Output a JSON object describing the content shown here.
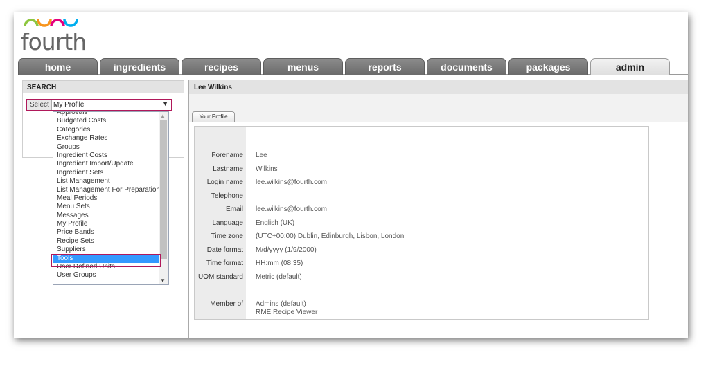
{
  "brand": {
    "logo_text": "fourth",
    "colors": [
      "#8dc63f",
      "#f7941d",
      "#e5007e",
      "#00aeef"
    ]
  },
  "tabs": [
    {
      "label": "home"
    },
    {
      "label": "ingredients"
    },
    {
      "label": "recipes"
    },
    {
      "label": "menus"
    },
    {
      "label": "reports"
    },
    {
      "label": "documents"
    },
    {
      "label": "packages"
    },
    {
      "label": "admin",
      "active": true
    }
  ],
  "search": {
    "title": "SEARCH",
    "select_label": "Select",
    "selected_value": "My Profile",
    "options": [
      "Approvals",
      "Budgeted Costs",
      "Categories",
      "Exchange Rates",
      "Groups",
      "Ingredient Costs",
      "Ingredient Import/Update",
      "Ingredient Sets",
      "List Management",
      "List Management For Preparation",
      "Meal Periods",
      "Menu Sets",
      "Messages",
      "My Profile",
      "Price Bands",
      "Recipe Sets",
      "Suppliers",
      "Tools",
      "User Defined Units",
      "User Groups"
    ],
    "highlighted_option": "Tools"
  },
  "content": {
    "header": "Lee Wilkins",
    "subtab": "Your Profile",
    "fields": [
      {
        "label": "Forename",
        "value": "Lee"
      },
      {
        "label": "Lastname",
        "value": "Wilkins"
      },
      {
        "label": "Login name",
        "value": "lee.wilkins@fourth.com"
      },
      {
        "label": "Telephone",
        "value": ""
      },
      {
        "label": "Email",
        "value": "lee.wilkins@fourth.com"
      },
      {
        "label": "Language",
        "value": "English (UK)"
      },
      {
        "label": "Time zone",
        "value": "(UTC+00:00) Dublin, Edinburgh, Lisbon, London"
      },
      {
        "label": "Date format",
        "value": "M/d/yyyy (1/9/2000)"
      },
      {
        "label": "Time format",
        "value": "HH:mm (08:35)"
      },
      {
        "label": "UOM standard",
        "value": "Metric (default)"
      }
    ],
    "member_of": {
      "label": "Member of",
      "values": [
        "Admins (default)",
        "RME Recipe Viewer"
      ]
    }
  }
}
